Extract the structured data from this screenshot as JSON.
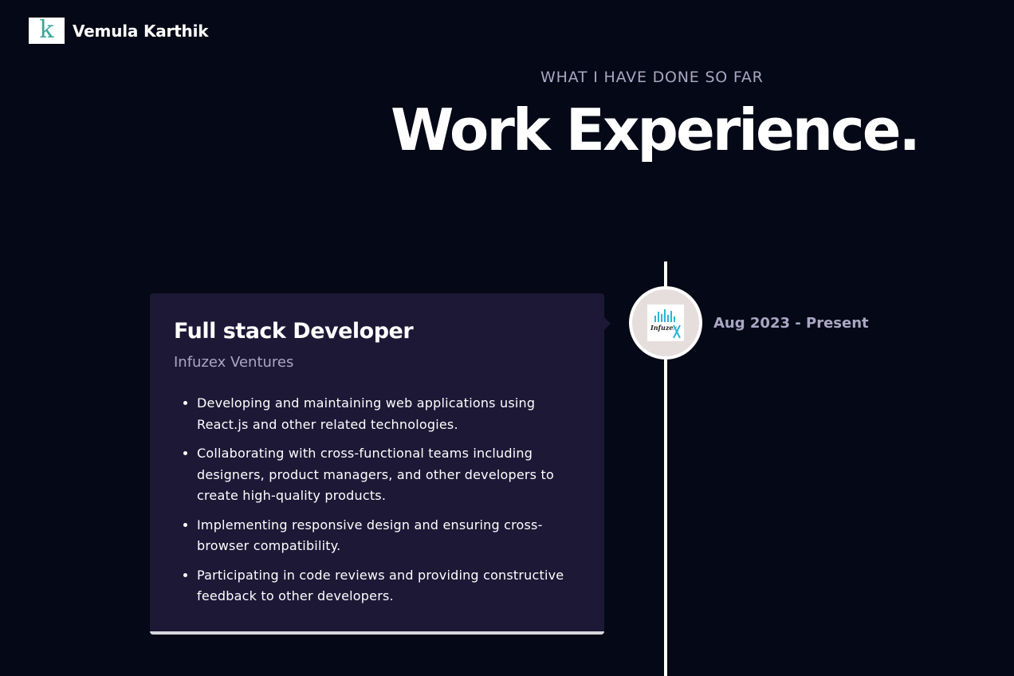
{
  "header": {
    "logo_letter": "k",
    "name": "Vemula Karthik"
  },
  "section": {
    "subtitle": "WHAT I HAVE DONE SO FAR",
    "title": "Work Experience."
  },
  "experience": [
    {
      "title": "Full stack Developer",
      "company": "Infuzex Ventures",
      "date": "Aug 2023 - Present",
      "logo_text": "Infuzex",
      "points": [
        "Developing and maintaining web applications using React.js and other related technologies.",
        "Collaborating with cross-functional teams including designers, product managers, and other developers to create high-quality products.",
        "Implementing responsive design and ensuring cross-browser compatibility.",
        "Participating in code reviews and providing constructive feedback to other developers."
      ]
    }
  ],
  "colors": {
    "background": "#050816",
    "card": "#1d1836",
    "secondary_text": "#aaa6c3",
    "logo_accent": "#3aa597",
    "infuzex_blue": "#2ab3d9"
  }
}
